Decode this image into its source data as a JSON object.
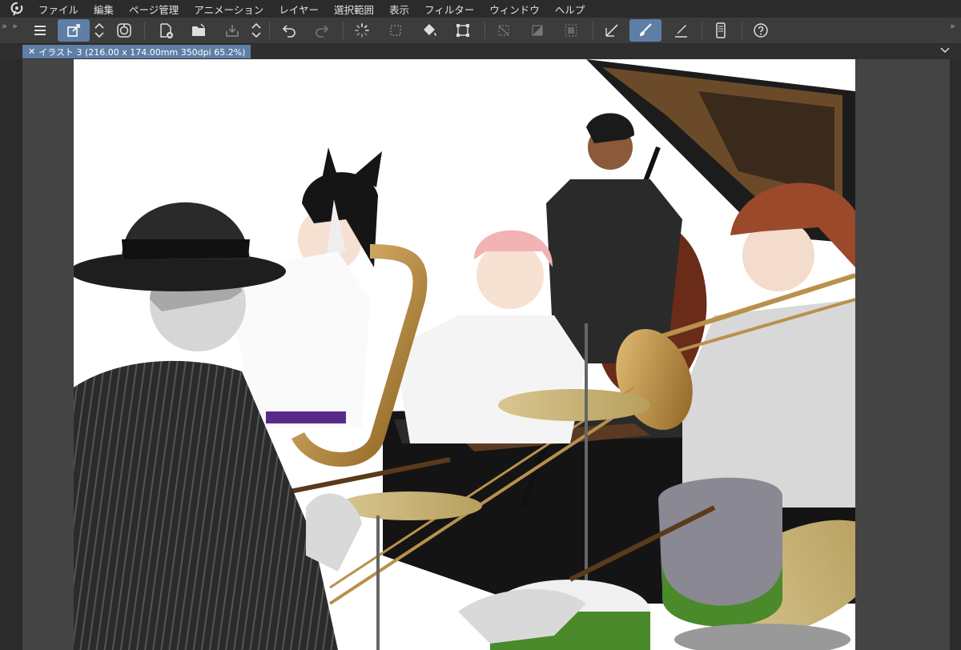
{
  "menu": {
    "items": [
      "ファイル",
      "編集",
      "ページ管理",
      "アニメーション",
      "レイヤー",
      "選択範囲",
      "表示",
      "フィルター",
      "ウィンドウ",
      "ヘルプ"
    ]
  },
  "toolbar": {
    "icons": [
      "hamburger-menu-icon",
      "drag-mode-icon",
      "up-down-arrows-icon",
      "rotate-view-icon",
      "new-file-icon",
      "open-folder-icon",
      "save-icon",
      "up-down-arrows-icon",
      "undo-icon",
      "redo-icon",
      "loading-spinner-icon",
      "selection-border-icon",
      "fill-bucket-icon",
      "crop-transform-icon",
      "clear-outside-icon",
      "fill-selection-icon",
      "expand-selection-icon",
      "ruler-icon",
      "brush-icon",
      "pen-line-icon",
      "smartphone-icon",
      "help-icon"
    ]
  },
  "document_tab": {
    "title": "イラスト 3 (216.00 x 174.00mm 350dpi 65.2%)"
  },
  "colors": {
    "accent": "#5f7ea6",
    "menubar_bg": "#2b2b2b",
    "toolbar_bg": "#3c3c3c",
    "workspace_bg": "#444444"
  }
}
